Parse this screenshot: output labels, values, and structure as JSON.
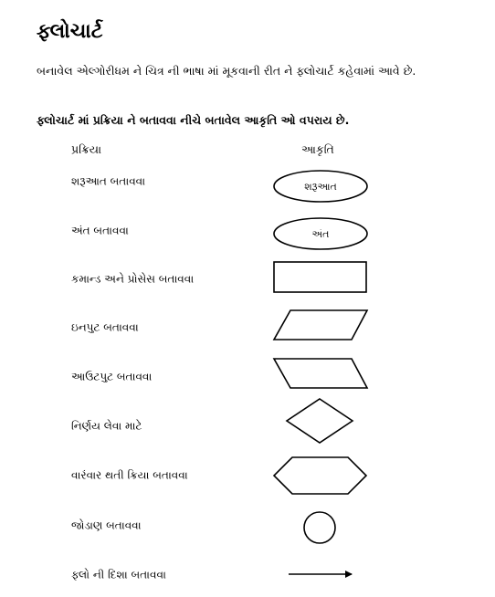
{
  "title": "ફ્લોચાર્ટ",
  "intro": "બનાવેલ એલ્ગોરીધમ ને ચિત્ર ની ભાષા માં મૂકવાની રીત ને ફ્લોચાર્ટ કહેવામાં આવે છે.",
  "subheading": "ફ્લોચાર્ટ માં પ્રક્રિયા ને બતાવવા નીચે બતાવેલ આકૃતિ ઓ વપરાય છે.",
  "columns": {
    "process": "પ્રક્રિયા",
    "shape": "આકૃતિ"
  },
  "rows": [
    {
      "label": "શરૂઆત બતાવવા",
      "shape": "terminator",
      "shape_text": "શરૂઆત"
    },
    {
      "label": "અંત બતાવવા",
      "shape": "terminator",
      "shape_text": "અંત"
    },
    {
      "label": "કમાન્ડ અને પ્રોસેસ બતાવવા",
      "shape": "rectangle"
    },
    {
      "label": "ઇનપુટ બતાવવા",
      "shape": "parallelogram"
    },
    {
      "label": "આઉટપુટ બતાવવા",
      "shape": "parallelogram"
    },
    {
      "label": "નિર્ણય લેવા માટે",
      "shape": "diamond"
    },
    {
      "label": "વારંવાર થતી ક્રિયા બતાવવા",
      "shape": "hexagon"
    },
    {
      "label": "જોડાણ બતાવવા",
      "shape": "circle"
    },
    {
      "label": "ફ્લો ની દિશા બતાવવા",
      "shape": "arrow"
    }
  ]
}
